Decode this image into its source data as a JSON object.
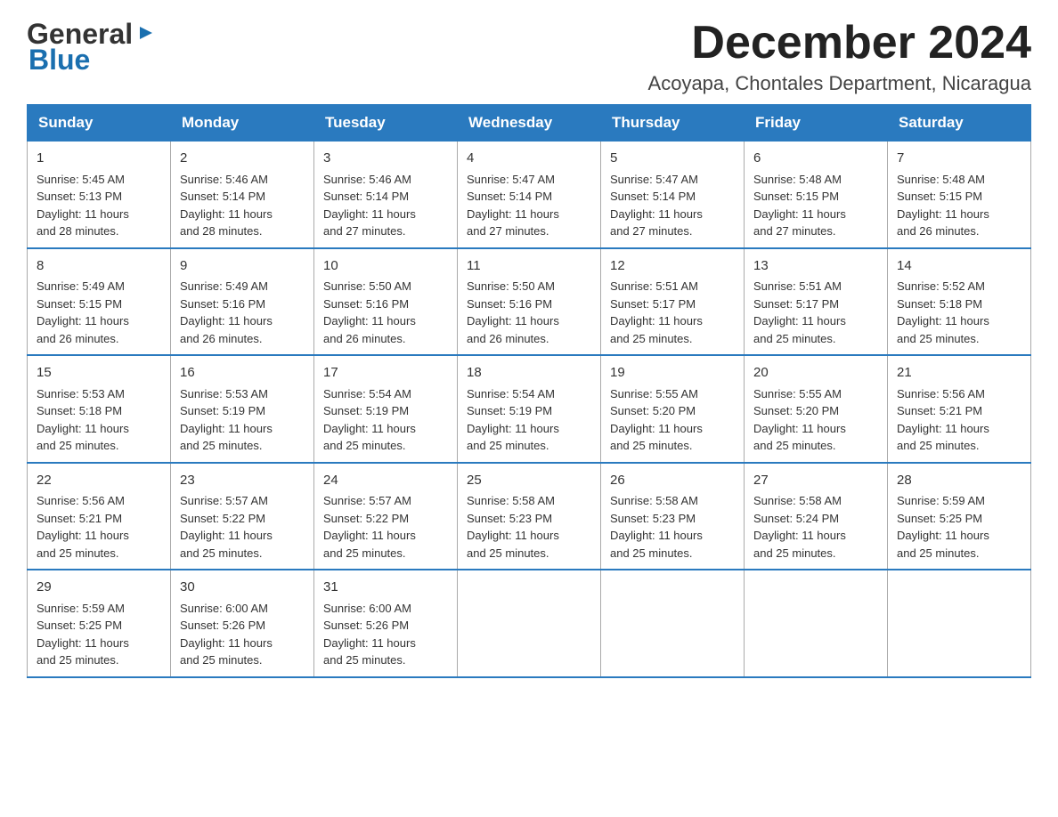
{
  "header": {
    "logo_general": "General",
    "logo_flag": "▶",
    "logo_blue": "Blue",
    "month_title": "December 2024",
    "location": "Acoyapa, Chontales Department, Nicaragua"
  },
  "days_of_week": [
    "Sunday",
    "Monday",
    "Tuesday",
    "Wednesday",
    "Thursday",
    "Friday",
    "Saturday"
  ],
  "weeks": [
    [
      {
        "day": "1",
        "sunrise": "5:45 AM",
        "sunset": "5:13 PM",
        "daylight": "11 hours and 28 minutes."
      },
      {
        "day": "2",
        "sunrise": "5:46 AM",
        "sunset": "5:14 PM",
        "daylight": "11 hours and 28 minutes."
      },
      {
        "day": "3",
        "sunrise": "5:46 AM",
        "sunset": "5:14 PM",
        "daylight": "11 hours and 27 minutes."
      },
      {
        "day": "4",
        "sunrise": "5:47 AM",
        "sunset": "5:14 PM",
        "daylight": "11 hours and 27 minutes."
      },
      {
        "day": "5",
        "sunrise": "5:47 AM",
        "sunset": "5:14 PM",
        "daylight": "11 hours and 27 minutes."
      },
      {
        "day": "6",
        "sunrise": "5:48 AM",
        "sunset": "5:15 PM",
        "daylight": "11 hours and 27 minutes."
      },
      {
        "day": "7",
        "sunrise": "5:48 AM",
        "sunset": "5:15 PM",
        "daylight": "11 hours and 26 minutes."
      }
    ],
    [
      {
        "day": "8",
        "sunrise": "5:49 AM",
        "sunset": "5:15 PM",
        "daylight": "11 hours and 26 minutes."
      },
      {
        "day": "9",
        "sunrise": "5:49 AM",
        "sunset": "5:16 PM",
        "daylight": "11 hours and 26 minutes."
      },
      {
        "day": "10",
        "sunrise": "5:50 AM",
        "sunset": "5:16 PM",
        "daylight": "11 hours and 26 minutes."
      },
      {
        "day": "11",
        "sunrise": "5:50 AM",
        "sunset": "5:16 PM",
        "daylight": "11 hours and 26 minutes."
      },
      {
        "day": "12",
        "sunrise": "5:51 AM",
        "sunset": "5:17 PM",
        "daylight": "11 hours and 25 minutes."
      },
      {
        "day": "13",
        "sunrise": "5:51 AM",
        "sunset": "5:17 PM",
        "daylight": "11 hours and 25 minutes."
      },
      {
        "day": "14",
        "sunrise": "5:52 AM",
        "sunset": "5:18 PM",
        "daylight": "11 hours and 25 minutes."
      }
    ],
    [
      {
        "day": "15",
        "sunrise": "5:53 AM",
        "sunset": "5:18 PM",
        "daylight": "11 hours and 25 minutes."
      },
      {
        "day": "16",
        "sunrise": "5:53 AM",
        "sunset": "5:19 PM",
        "daylight": "11 hours and 25 minutes."
      },
      {
        "day": "17",
        "sunrise": "5:54 AM",
        "sunset": "5:19 PM",
        "daylight": "11 hours and 25 minutes."
      },
      {
        "day": "18",
        "sunrise": "5:54 AM",
        "sunset": "5:19 PM",
        "daylight": "11 hours and 25 minutes."
      },
      {
        "day": "19",
        "sunrise": "5:55 AM",
        "sunset": "5:20 PM",
        "daylight": "11 hours and 25 minutes."
      },
      {
        "day": "20",
        "sunrise": "5:55 AM",
        "sunset": "5:20 PM",
        "daylight": "11 hours and 25 minutes."
      },
      {
        "day": "21",
        "sunrise": "5:56 AM",
        "sunset": "5:21 PM",
        "daylight": "11 hours and 25 minutes."
      }
    ],
    [
      {
        "day": "22",
        "sunrise": "5:56 AM",
        "sunset": "5:21 PM",
        "daylight": "11 hours and 25 minutes."
      },
      {
        "day": "23",
        "sunrise": "5:57 AM",
        "sunset": "5:22 PM",
        "daylight": "11 hours and 25 minutes."
      },
      {
        "day": "24",
        "sunrise": "5:57 AM",
        "sunset": "5:22 PM",
        "daylight": "11 hours and 25 minutes."
      },
      {
        "day": "25",
        "sunrise": "5:58 AM",
        "sunset": "5:23 PM",
        "daylight": "11 hours and 25 minutes."
      },
      {
        "day": "26",
        "sunrise": "5:58 AM",
        "sunset": "5:23 PM",
        "daylight": "11 hours and 25 minutes."
      },
      {
        "day": "27",
        "sunrise": "5:58 AM",
        "sunset": "5:24 PM",
        "daylight": "11 hours and 25 minutes."
      },
      {
        "day": "28",
        "sunrise": "5:59 AM",
        "sunset": "5:25 PM",
        "daylight": "11 hours and 25 minutes."
      }
    ],
    [
      {
        "day": "29",
        "sunrise": "5:59 AM",
        "sunset": "5:25 PM",
        "daylight": "11 hours and 25 minutes."
      },
      {
        "day": "30",
        "sunrise": "6:00 AM",
        "sunset": "5:26 PM",
        "daylight": "11 hours and 25 minutes."
      },
      {
        "day": "31",
        "sunrise": "6:00 AM",
        "sunset": "5:26 PM",
        "daylight": "11 hours and 25 minutes."
      },
      null,
      null,
      null,
      null
    ]
  ],
  "labels": {
    "sunrise": "Sunrise:",
    "sunset": "Sunset:",
    "daylight": "Daylight:"
  }
}
